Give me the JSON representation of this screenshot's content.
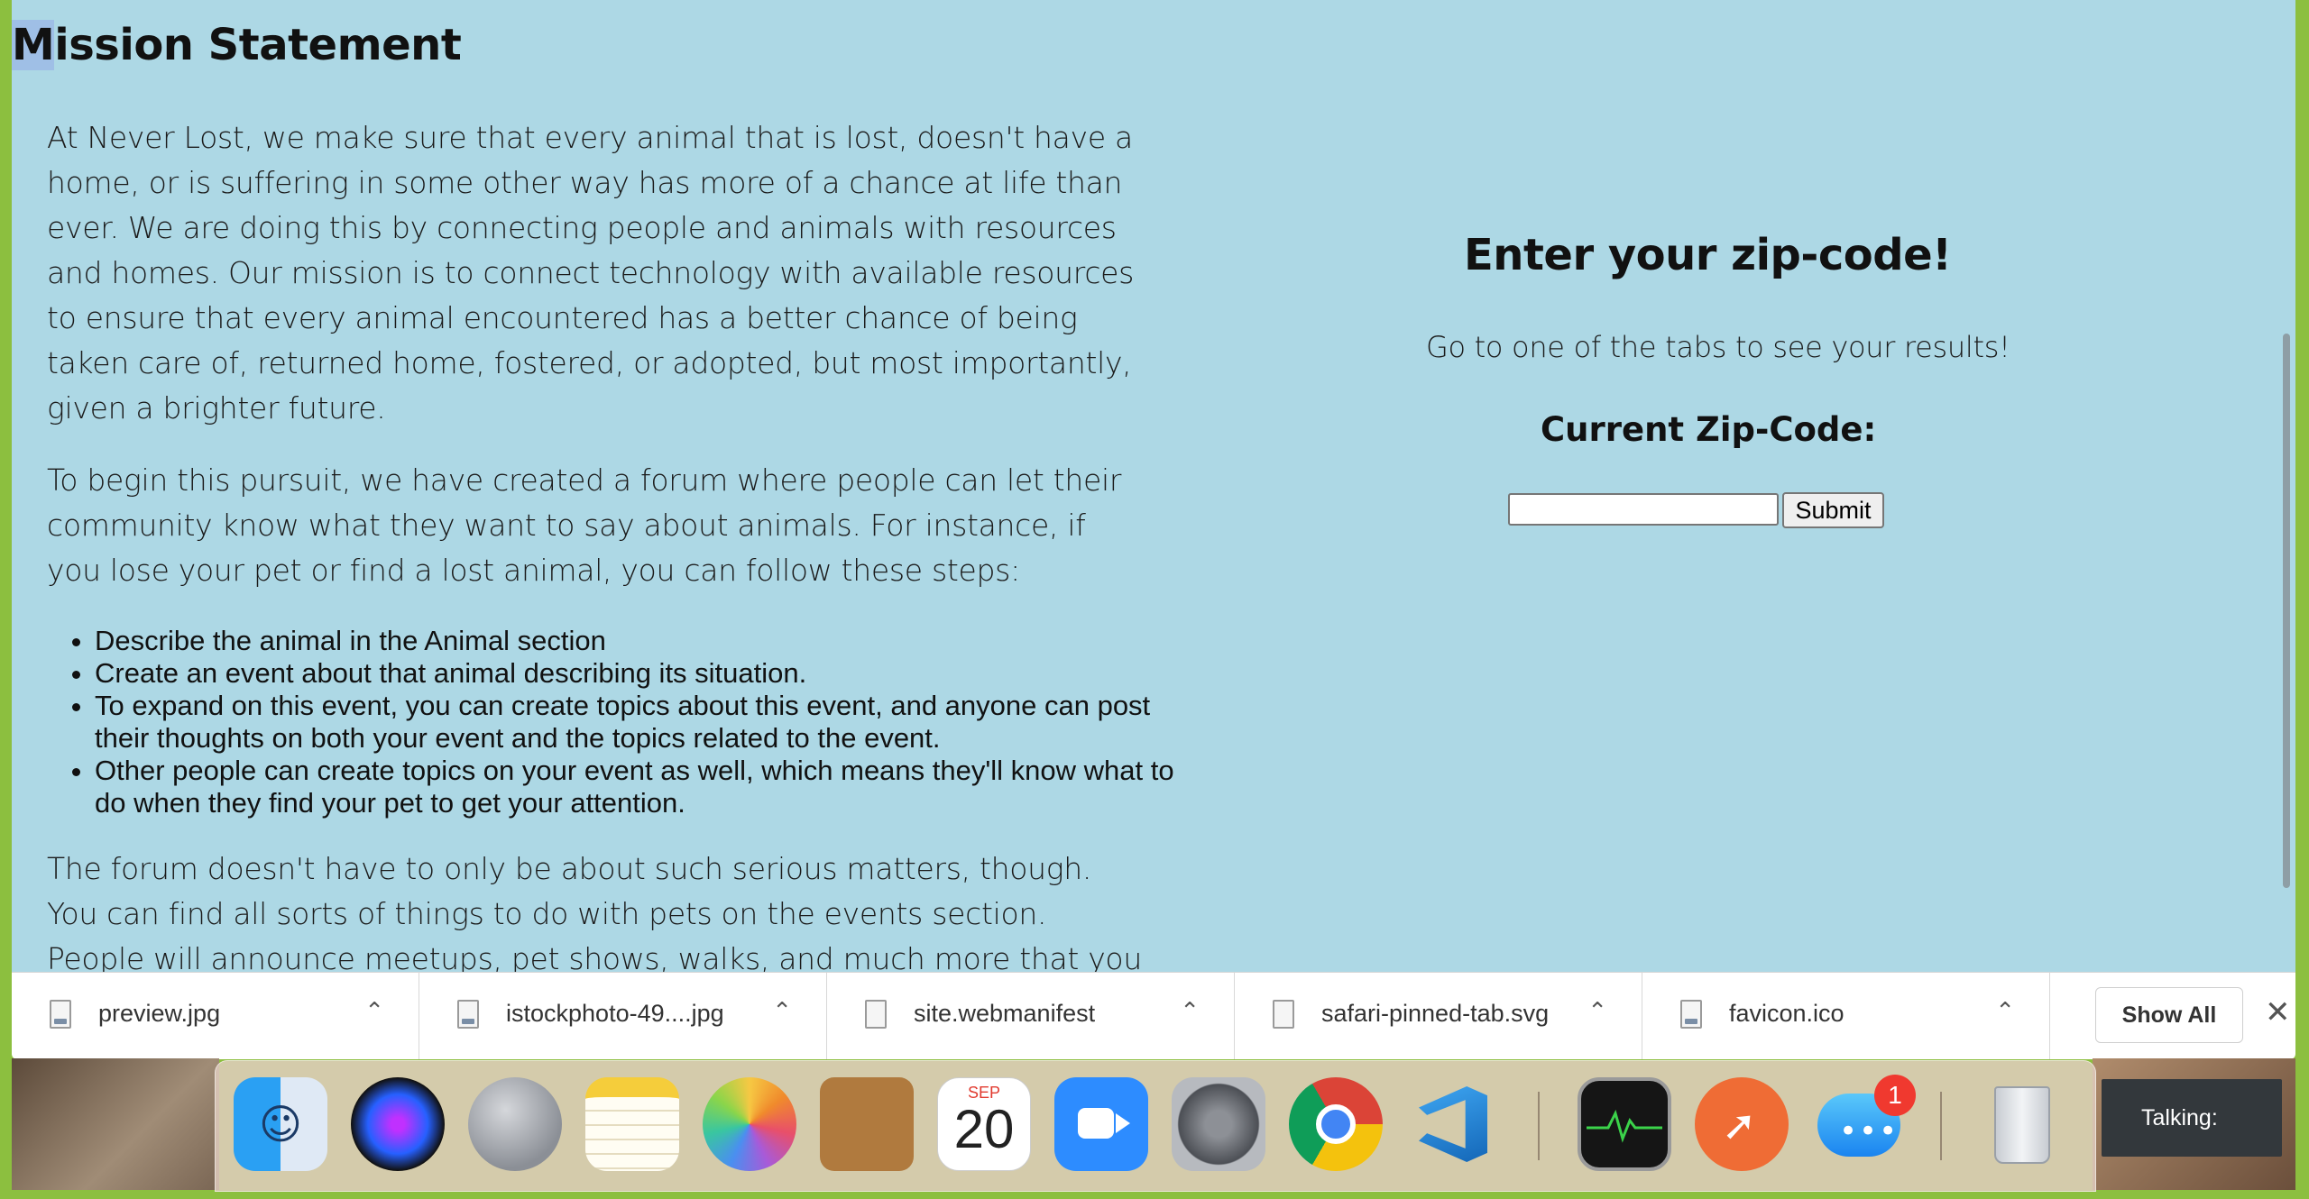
{
  "mission": {
    "title_first": "M",
    "title_rest": "ission Statement",
    "paragraph1": "At Never Lost, we make sure that every animal that is lost, doesn't have a home, or is suffering in some other way has more of a chance at life than ever. We are doing this by connecting people and animals with resources and homes. Our mission is to connect technology with available resources to ensure that every animal encountered has a better chance of being taken care of, returned home, fostered, or adopted, but most importantly, given a brighter future.",
    "paragraph2": "To begin this pursuit, we have created a forum where people can let their community know what they want to say about animals. For instance, if you lose your pet or find a lost animal, you can follow these steps:",
    "steps": [
      "Describe the animal in the Animal section",
      "Create an event about that animal describing its situation.",
      "To expand on this event, you can create topics about this event, and anyone can post their thoughts on both your event and the topics related to the event.",
      "Other people can create topics on your event as well, which means they'll know what to do when they find your pet to get your attention."
    ],
    "paragraph3": "The forum doesn't have to only be about such serious matters, though. You can find all sorts of things to do with pets on the events section. People will announce meetups, pet shows, walks, and much more that you can talk"
  },
  "zip": {
    "title": "Enter your zip-code!",
    "subtitle": "Go to one of the tabs to see your results!",
    "current_label": "Current Zip-Code:",
    "input_value": "",
    "submit_label": "Submit"
  },
  "downloads": {
    "items": [
      {
        "name": "preview.jpg",
        "icon": "jpeg-file-icon"
      },
      {
        "name": "istockphoto-49....jpg",
        "icon": "jpeg-file-icon"
      },
      {
        "name": "site.webmanifest",
        "icon": "blank-file-icon"
      },
      {
        "name": "safari-pinned-tab.svg",
        "icon": "text-file-icon"
      },
      {
        "name": "favicon.ico",
        "icon": "ico-file-icon"
      }
    ],
    "show_all_label": "Show All",
    "close_icon": "✕"
  },
  "dock": {
    "calendar_month": "SEP",
    "calendar_day": "20",
    "messages_badge": "1"
  },
  "talking_label": "Talking:"
}
